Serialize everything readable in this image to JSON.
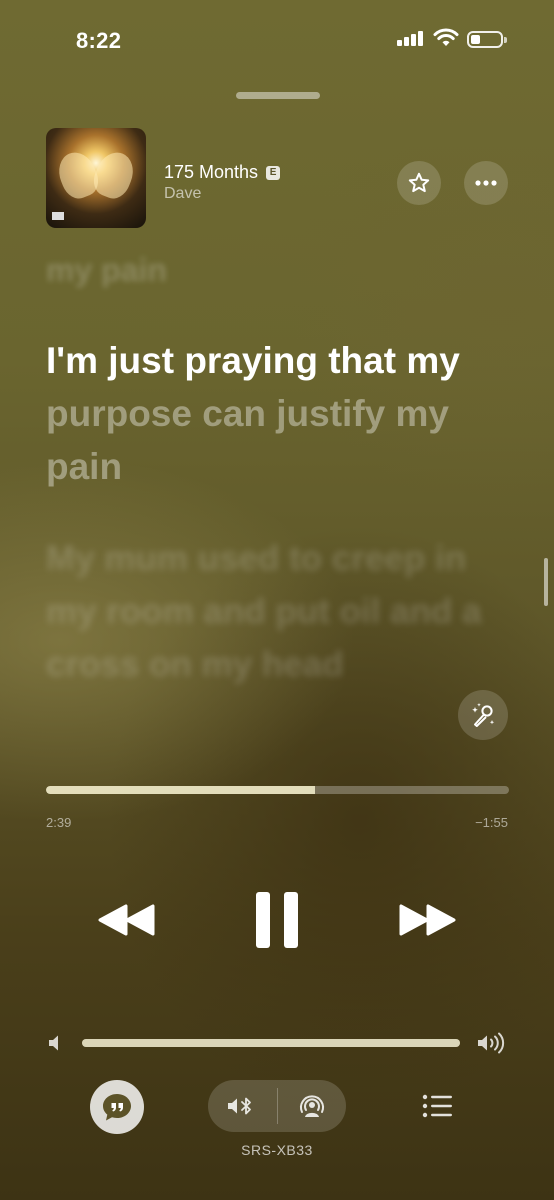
{
  "status_bar": {
    "time": "8:22"
  },
  "now_playing": {
    "title": "175 Months",
    "explicit_badge": "E",
    "artist": "Dave"
  },
  "lyrics": {
    "previous_line": "my pain",
    "current_sung": "I'm just praying that my",
    "current_unsung": " purpose can justify my pain",
    "next_line": "My mum used to creep in my room and put oil and a cross on my head"
  },
  "playback": {
    "elapsed": "2:39",
    "remaining": "−1:55",
    "progress_fraction": 0.58,
    "state": "playing",
    "volume_fraction": 1.0
  },
  "output_device": {
    "name": "SRS-XB33"
  },
  "icons": {
    "star": "star-icon",
    "more": "ellipsis-icon",
    "sing": "microphone-sparkle-icon",
    "rewind": "rewind-icon",
    "pause": "pause-icon",
    "fast_forward": "fast-forward-icon",
    "volume_low": "speaker-low-icon",
    "volume_high": "speaker-high-icon",
    "lyrics": "quote-bubble-icon",
    "bluetooth_speaker": "speaker-bluetooth-icon",
    "airplay": "airplay-audio-icon",
    "queue": "list-icon"
  },
  "colors": {
    "background_top": "#6f6a32",
    "background_bottom": "#3d3314",
    "progress_fill": "#ebe6c3"
  }
}
